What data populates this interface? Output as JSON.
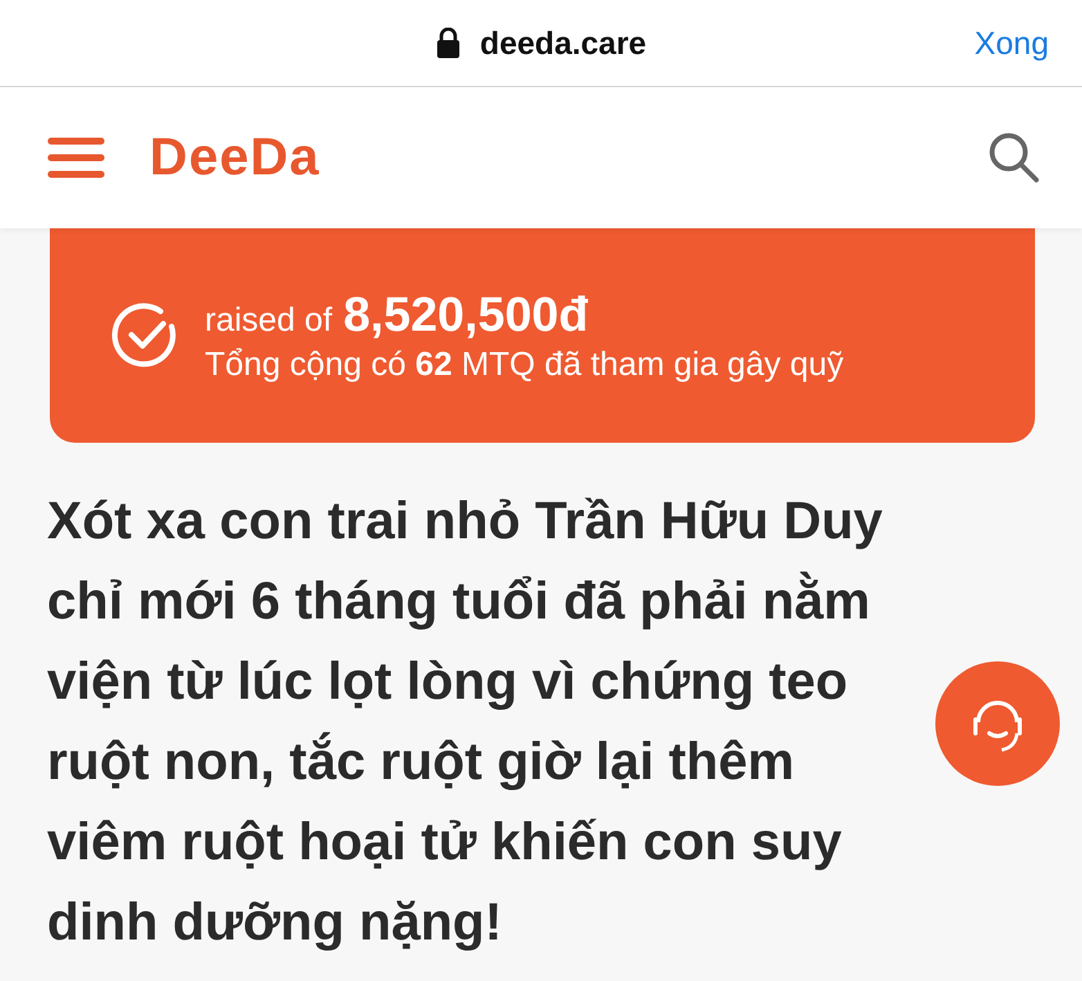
{
  "browser_bar": {
    "address": "deeda.care",
    "done_label": "Xong"
  },
  "header": {
    "logo": "DeeDa"
  },
  "banner": {
    "raised_label": "raised of",
    "amount": "8,520,500đ",
    "supporters": "Tổng cộng có **62** MTQ đã tham gia gây quỹ"
  },
  "article": {
    "title": "Xót xa con trai nhỏ Trần Hữu Duy\nchỉ mới 6 tháng tuổi đã phải nằm\nviện từ lúc lọt lòng vì chứng teo\nruột non, tắc ruột giờ lại thêm\nviêm ruột hoại tử khiến con suy\ndinh dưỡng nặng!"
  }
}
